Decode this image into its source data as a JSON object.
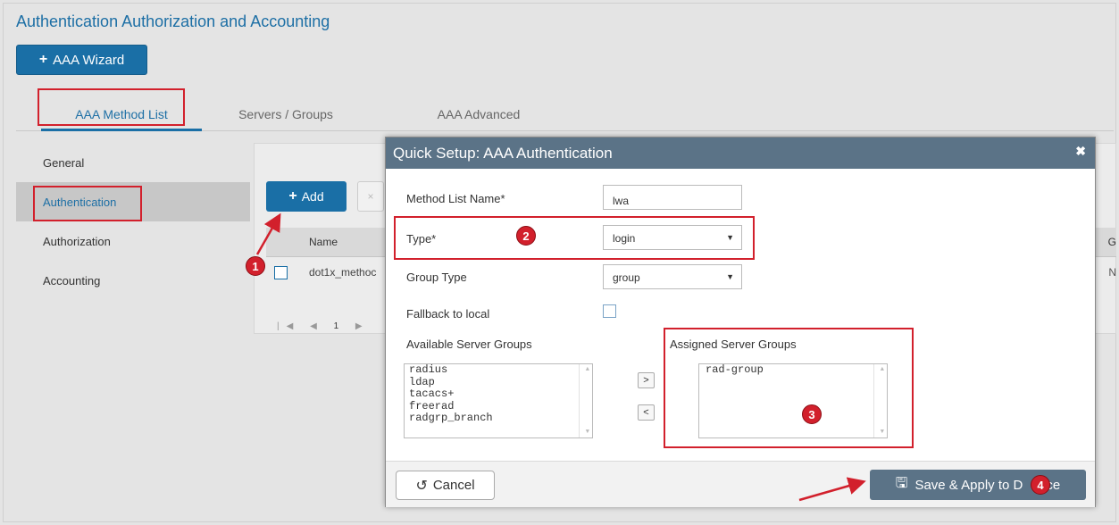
{
  "page": {
    "title": "Authentication Authorization and Accounting",
    "wizard_button": "AAA Wizard"
  },
  "tabs": [
    {
      "label": "AAA Method List",
      "active": true
    },
    {
      "label": "Servers / Groups",
      "active": false
    },
    {
      "label": "AAA Advanced",
      "active": false
    }
  ],
  "sidebar": {
    "items": [
      {
        "label": "General",
        "active": false
      },
      {
        "label": "Authentication",
        "active": true
      },
      {
        "label": "Authorization",
        "active": false
      },
      {
        "label": "Accounting",
        "active": false
      }
    ]
  },
  "toolbar": {
    "add_label": "Add",
    "delete_label": "×"
  },
  "grid": {
    "columns": [
      "Name",
      "G"
    ],
    "rows": [
      {
        "name": "dot1x_methoc",
        "extra": "N"
      }
    ],
    "pager": {
      "first": "|◀",
      "prev": "◀",
      "page": "1",
      "next": "▶"
    }
  },
  "modal": {
    "title": "Quick Setup: AAA Authentication",
    "close": "✖",
    "method_list_name_label": "Method List Name*",
    "method_list_name_value": "lwa",
    "type_label": "Type*",
    "type_value": "login",
    "group_type_label": "Group Type",
    "group_type_value": "group",
    "fallback_label": "Fallback to local",
    "fallback_checked": false,
    "available_label": "Available Server Groups",
    "available_groups": [
      "radius",
      "ldap",
      "tacacs+",
      "freerad",
      "radgrp_branch"
    ],
    "assigned_label": "Assigned Server Groups",
    "assigned_groups": [
      "rad-group"
    ],
    "move_right": ">",
    "move_left": "<",
    "cancel_label": "Cancel",
    "save_label": "Save & Apply to D"
  },
  "callouts": [
    "1",
    "2",
    "3",
    "4"
  ],
  "colors": {
    "brand_blue": "#1a6fa6",
    "modal_header": "#5b7387",
    "callout_red": "#d2202c"
  }
}
